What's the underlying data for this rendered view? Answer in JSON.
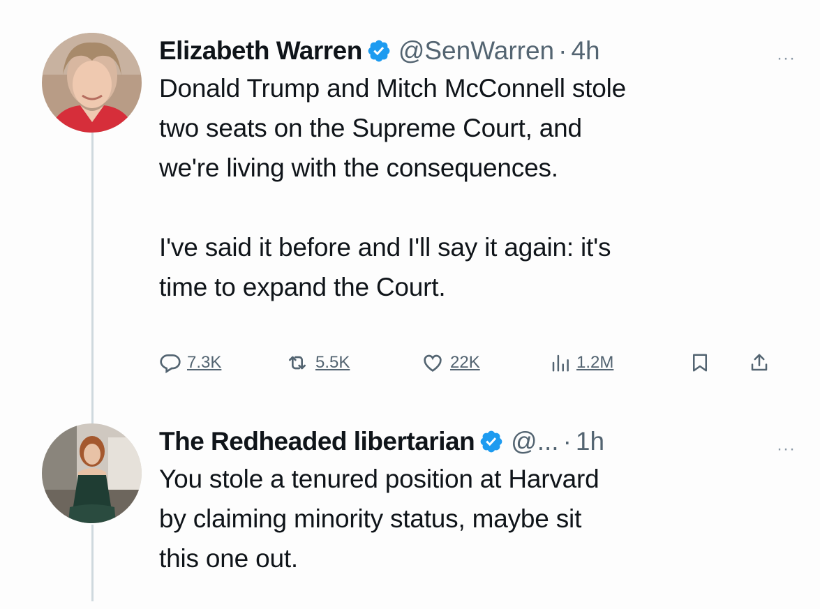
{
  "thread": [
    {
      "author": {
        "name": "Elizabeth Warren",
        "handle": "@SenWarren",
        "time": "4h",
        "verified": true,
        "avatar_icon": "profile-photo"
      },
      "more_label": "···",
      "paragraphs": [
        [
          "Donald Trump and Mitch McConnell stole",
          "two seats on the Supreme Court, and",
          "we're living with the consequences."
        ],
        [
          "I've said it before and I'll say it again: it's",
          "time to expand the Court."
        ]
      ],
      "actions": {
        "replies": "7.3K",
        "reposts": "5.5K",
        "likes": "22K",
        "views": "1.2M"
      }
    },
    {
      "author": {
        "name": "The Redheaded libertarian",
        "handle": "@...",
        "time": "1h",
        "verified": true,
        "avatar_icon": "profile-photo"
      },
      "more_label": "···",
      "paragraphs": [
        [
          "You stole a tenured position at Harvard",
          "by claiming minority status, maybe sit",
          "this one out."
        ]
      ]
    }
  ],
  "separator": "·",
  "colors": {
    "verified": "#1d9bf0",
    "secondary_text": "#536471",
    "thread_line": "#cfd9de"
  }
}
